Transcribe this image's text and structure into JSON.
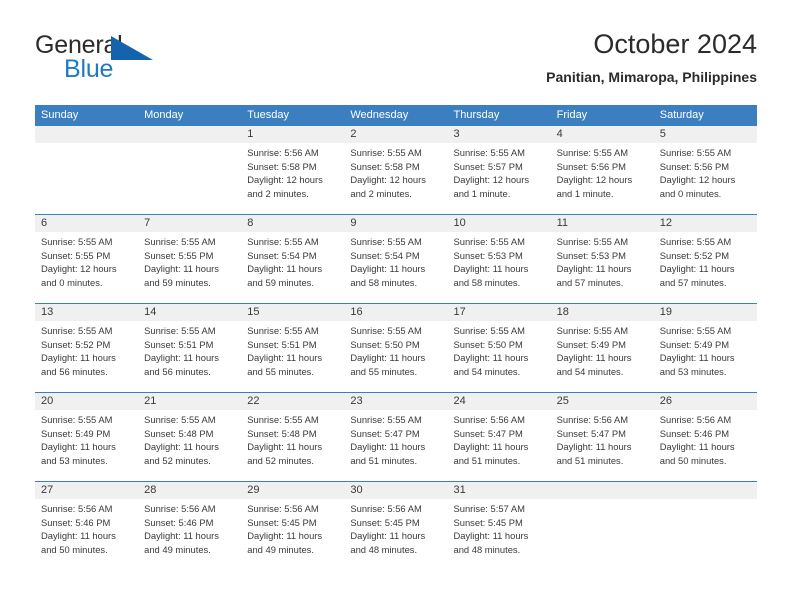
{
  "logo": {
    "word1": "General",
    "word2": "Blue",
    "triangle_icon": "triangle-icon",
    "color_dark": "#2b2b2b",
    "color_blue": "#1f7ac4"
  },
  "header": {
    "title": "October 2024",
    "subtitle": "Panitian, Mimaropa, Philippines"
  },
  "theme": {
    "header_blue": "#3c7fc0",
    "row_separator": "#3c7fc0",
    "daynum_band": "#f0f0f0",
    "text": "#3a3a3a"
  },
  "weekdays": [
    "Sunday",
    "Monday",
    "Tuesday",
    "Wednesday",
    "Thursday",
    "Friday",
    "Saturday"
  ],
  "weeks": [
    [
      {
        "day": "",
        "lines": []
      },
      {
        "day": "",
        "lines": []
      },
      {
        "day": "1",
        "lines": [
          "Sunrise: 5:56 AM",
          "Sunset: 5:58 PM",
          "Daylight: 12 hours",
          "and 2 minutes."
        ]
      },
      {
        "day": "2",
        "lines": [
          "Sunrise: 5:55 AM",
          "Sunset: 5:58 PM",
          "Daylight: 12 hours",
          "and 2 minutes."
        ]
      },
      {
        "day": "3",
        "lines": [
          "Sunrise: 5:55 AM",
          "Sunset: 5:57 PM",
          "Daylight: 12 hours",
          "and 1 minute."
        ]
      },
      {
        "day": "4",
        "lines": [
          "Sunrise: 5:55 AM",
          "Sunset: 5:56 PM",
          "Daylight: 12 hours",
          "and 1 minute."
        ]
      },
      {
        "day": "5",
        "lines": [
          "Sunrise: 5:55 AM",
          "Sunset: 5:56 PM",
          "Daylight: 12 hours",
          "and 0 minutes."
        ]
      }
    ],
    [
      {
        "day": "6",
        "lines": [
          "Sunrise: 5:55 AM",
          "Sunset: 5:55 PM",
          "Daylight: 12 hours",
          "and 0 minutes."
        ]
      },
      {
        "day": "7",
        "lines": [
          "Sunrise: 5:55 AM",
          "Sunset: 5:55 PM",
          "Daylight: 11 hours",
          "and 59 minutes."
        ]
      },
      {
        "day": "8",
        "lines": [
          "Sunrise: 5:55 AM",
          "Sunset: 5:54 PM",
          "Daylight: 11 hours",
          "and 59 minutes."
        ]
      },
      {
        "day": "9",
        "lines": [
          "Sunrise: 5:55 AM",
          "Sunset: 5:54 PM",
          "Daylight: 11 hours",
          "and 58 minutes."
        ]
      },
      {
        "day": "10",
        "lines": [
          "Sunrise: 5:55 AM",
          "Sunset: 5:53 PM",
          "Daylight: 11 hours",
          "and 58 minutes."
        ]
      },
      {
        "day": "11",
        "lines": [
          "Sunrise: 5:55 AM",
          "Sunset: 5:53 PM",
          "Daylight: 11 hours",
          "and 57 minutes."
        ]
      },
      {
        "day": "12",
        "lines": [
          "Sunrise: 5:55 AM",
          "Sunset: 5:52 PM",
          "Daylight: 11 hours",
          "and 57 minutes."
        ]
      }
    ],
    [
      {
        "day": "13",
        "lines": [
          "Sunrise: 5:55 AM",
          "Sunset: 5:52 PM",
          "Daylight: 11 hours",
          "and 56 minutes."
        ]
      },
      {
        "day": "14",
        "lines": [
          "Sunrise: 5:55 AM",
          "Sunset: 5:51 PM",
          "Daylight: 11 hours",
          "and 56 minutes."
        ]
      },
      {
        "day": "15",
        "lines": [
          "Sunrise: 5:55 AM",
          "Sunset: 5:51 PM",
          "Daylight: 11 hours",
          "and 55 minutes."
        ]
      },
      {
        "day": "16",
        "lines": [
          "Sunrise: 5:55 AM",
          "Sunset: 5:50 PM",
          "Daylight: 11 hours",
          "and 55 minutes."
        ]
      },
      {
        "day": "17",
        "lines": [
          "Sunrise: 5:55 AM",
          "Sunset: 5:50 PM",
          "Daylight: 11 hours",
          "and 54 minutes."
        ]
      },
      {
        "day": "18",
        "lines": [
          "Sunrise: 5:55 AM",
          "Sunset: 5:49 PM",
          "Daylight: 11 hours",
          "and 54 minutes."
        ]
      },
      {
        "day": "19",
        "lines": [
          "Sunrise: 5:55 AM",
          "Sunset: 5:49 PM",
          "Daylight: 11 hours",
          "and 53 minutes."
        ]
      }
    ],
    [
      {
        "day": "20",
        "lines": [
          "Sunrise: 5:55 AM",
          "Sunset: 5:49 PM",
          "Daylight: 11 hours",
          "and 53 minutes."
        ]
      },
      {
        "day": "21",
        "lines": [
          "Sunrise: 5:55 AM",
          "Sunset: 5:48 PM",
          "Daylight: 11 hours",
          "and 52 minutes."
        ]
      },
      {
        "day": "22",
        "lines": [
          "Sunrise: 5:55 AM",
          "Sunset: 5:48 PM",
          "Daylight: 11 hours",
          "and 52 minutes."
        ]
      },
      {
        "day": "23",
        "lines": [
          "Sunrise: 5:55 AM",
          "Sunset: 5:47 PM",
          "Daylight: 11 hours",
          "and 51 minutes."
        ]
      },
      {
        "day": "24",
        "lines": [
          "Sunrise: 5:56 AM",
          "Sunset: 5:47 PM",
          "Daylight: 11 hours",
          "and 51 minutes."
        ]
      },
      {
        "day": "25",
        "lines": [
          "Sunrise: 5:56 AM",
          "Sunset: 5:47 PM",
          "Daylight: 11 hours",
          "and 51 minutes."
        ]
      },
      {
        "day": "26",
        "lines": [
          "Sunrise: 5:56 AM",
          "Sunset: 5:46 PM",
          "Daylight: 11 hours",
          "and 50 minutes."
        ]
      }
    ],
    [
      {
        "day": "27",
        "lines": [
          "Sunrise: 5:56 AM",
          "Sunset: 5:46 PM",
          "Daylight: 11 hours",
          "and 50 minutes."
        ]
      },
      {
        "day": "28",
        "lines": [
          "Sunrise: 5:56 AM",
          "Sunset: 5:46 PM",
          "Daylight: 11 hours",
          "and 49 minutes."
        ]
      },
      {
        "day": "29",
        "lines": [
          "Sunrise: 5:56 AM",
          "Sunset: 5:45 PM",
          "Daylight: 11 hours",
          "and 49 minutes."
        ]
      },
      {
        "day": "30",
        "lines": [
          "Sunrise: 5:56 AM",
          "Sunset: 5:45 PM",
          "Daylight: 11 hours",
          "and 48 minutes."
        ]
      },
      {
        "day": "31",
        "lines": [
          "Sunrise: 5:57 AM",
          "Sunset: 5:45 PM",
          "Daylight: 11 hours",
          "and 48 minutes."
        ]
      },
      {
        "day": "",
        "lines": []
      },
      {
        "day": "",
        "lines": []
      }
    ]
  ]
}
